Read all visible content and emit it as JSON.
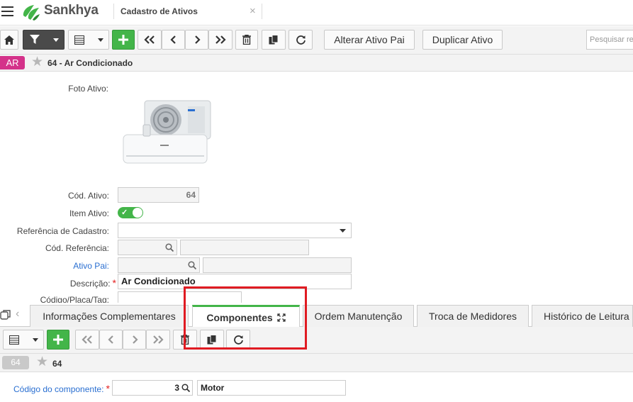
{
  "header": {
    "brand": "Sankhya",
    "tab_title": "Cadastro de Ativos",
    "tab_close": "×"
  },
  "toolbar": {
    "alterar_label": "Alterar Ativo Pai",
    "duplicar_label": "Duplicar Ativo",
    "search_placeholder": "Pesquisar re"
  },
  "record": {
    "badge": "AR",
    "title": "64 - Ar Condicionado"
  },
  "form": {
    "foto_label": "Foto Ativo:",
    "cod_ativo_label": "Cód. Ativo:",
    "cod_ativo_value": "64",
    "item_ativo_label": "Item Ativo:",
    "referencia_label": "Referência de Cadastro:",
    "cod_referencia_label": "Cód. Referência:",
    "ativo_pai_label": "Ativo Pai:",
    "descricao_label": "Descrição:",
    "descricao_value": "Ar Condicionado",
    "codigo_placa_label": "Código/Placa/Tag:",
    "required_mark": "*"
  },
  "tabs": [
    {
      "label": "Informações Complementares"
    },
    {
      "label": "Componentes"
    },
    {
      "label": "Ordem Manutenção"
    },
    {
      "label": "Troca de Medidores"
    },
    {
      "label": "Histórico de Leitura"
    }
  ],
  "sub_record": {
    "badge": "64",
    "title": "64"
  },
  "componente": {
    "label": "Código do componente:",
    "code_value": "3",
    "name_value": "Motor",
    "required_mark": "*"
  },
  "colors": {
    "accent_green": "#43b549",
    "badge_magenta": "#d4328a",
    "highlight_red": "#e01b22",
    "link_blue": "#2a6fd1"
  },
  "icons": {
    "menu": "hamburger-icon",
    "home": "home-icon",
    "filter": "filter-icon",
    "grid": "grid-icon",
    "add": "plus-icon",
    "first": "double-chevron-left-icon",
    "prev": "chevron-left-icon",
    "next": "chevron-right-icon",
    "last": "double-chevron-right-icon",
    "delete": "trash-icon",
    "copy": "copy-icon",
    "refresh": "refresh-icon",
    "search": "search-icon",
    "favorite": "star-icon",
    "expand": "expand-icon"
  }
}
